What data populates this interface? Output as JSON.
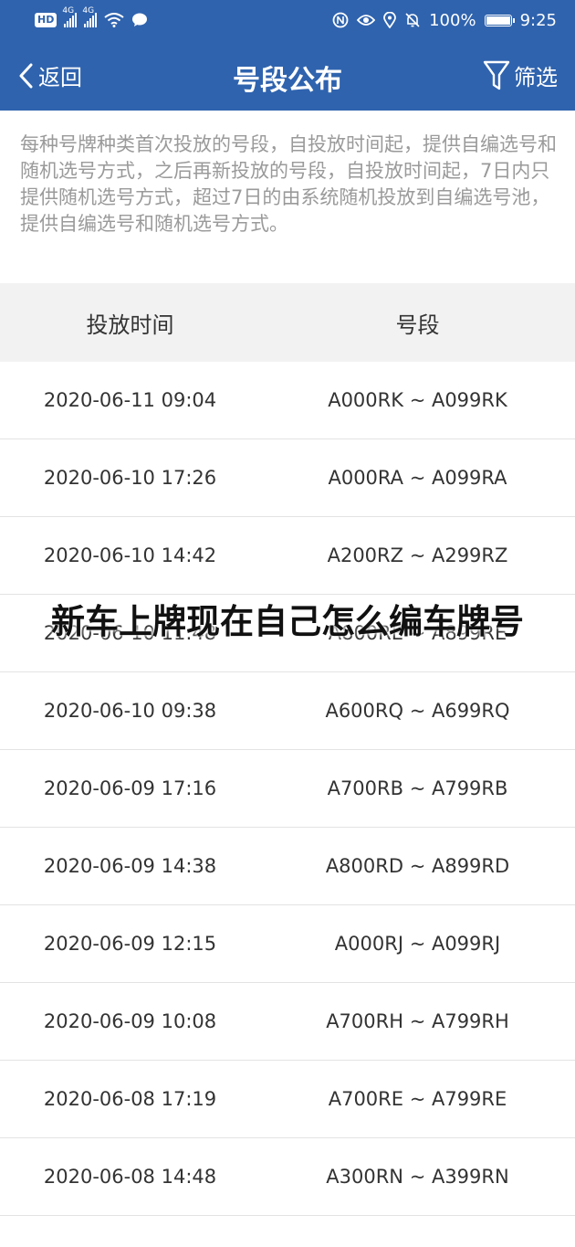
{
  "status_bar": {
    "hd_label": "HD",
    "signal_1": "4G",
    "signal_2": "4G",
    "battery_percent": "100%",
    "time": "9:25"
  },
  "nav": {
    "back_label": "返回",
    "title": "号段公布",
    "filter_label": "筛选"
  },
  "notice": "每种号牌种类首次投放的号段，自投放时间起，提供自编选号和随机选号方式，之后再新投放的号段，自投放时间起，7日内只提供随机选号方式，超过7日的由系统随机投放到自编选号池，提供自编选号和随机选号方式。",
  "table": {
    "headers": [
      "投放时间",
      "号段"
    ],
    "rows": [
      {
        "time": "2020-06-11 09:04",
        "range": "A000RK ~ A099RK"
      },
      {
        "time": "2020-06-10 17:26",
        "range": "A000RA ~ A099RA"
      },
      {
        "time": "2020-06-10 14:42",
        "range": "A200RZ ~ A299RZ"
      },
      {
        "time": "2020-06-10 11:48",
        "range": "A800RE ~ A899RE"
      },
      {
        "time": "2020-06-10 09:38",
        "range": "A600RQ ~ A699RQ"
      },
      {
        "time": "2020-06-09 17:16",
        "range": "A700RB ~ A799RB"
      },
      {
        "time": "2020-06-09 14:38",
        "range": "A800RD ~ A899RD"
      },
      {
        "time": "2020-06-09 12:15",
        "range": "A000RJ ~ A099RJ"
      },
      {
        "time": "2020-06-09 10:08",
        "range": "A700RH ~ A799RH"
      },
      {
        "time": "2020-06-08 17:19",
        "range": "A700RE ~ A799RE"
      },
      {
        "time": "2020-06-08 14:48",
        "range": "A300RN ~ A399RN"
      }
    ]
  },
  "overlay_caption": "新车上牌现在自己怎么编车牌号"
}
